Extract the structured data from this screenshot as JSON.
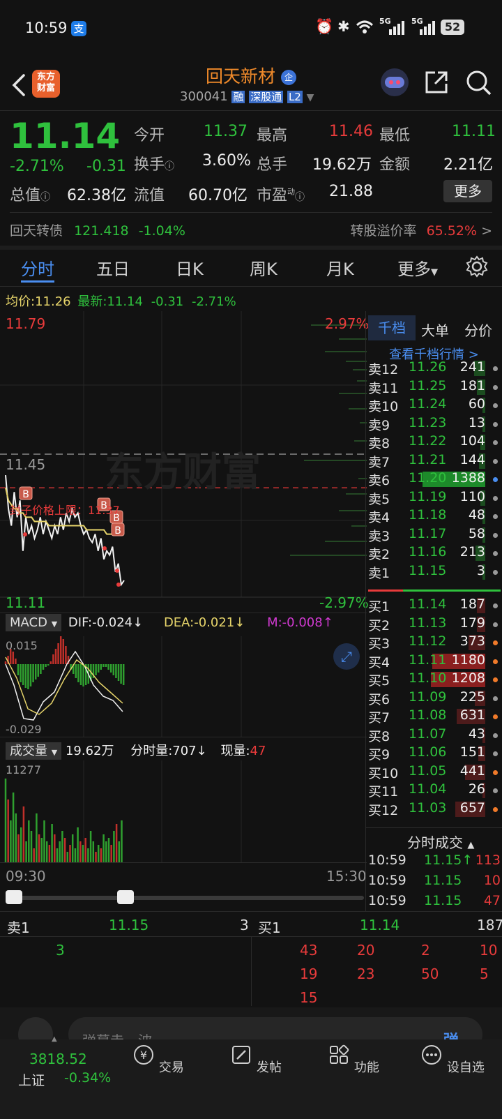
{
  "status": {
    "time": "10:59",
    "pay_badge": "支",
    "battery": "52",
    "net1": "5G",
    "net2": "5G"
  },
  "header": {
    "logo_text": "东方\n财富",
    "stock_name": "回天新材",
    "badge_qi": "企",
    "code": "300041",
    "tag_rong": "融",
    "tag_sgt": "深股通",
    "tag_l2": "L2"
  },
  "quote": {
    "price": "11.14",
    "change_pct": "-2.71%",
    "change": "-0.31",
    "open_label": "今开",
    "open": "11.37",
    "high_label": "最高",
    "high": "11.46",
    "low_label": "最低",
    "low": "11.11",
    "turnover_label": "换手",
    "turnover": "3.60%",
    "volume_label": "总手",
    "volume": "19.62万",
    "amount_label": "金额",
    "amount": "2.21亿",
    "mktcap_label": "总值",
    "mktcap": "62.38亿",
    "float_label": "流值",
    "float": "60.70亿",
    "pe_label": "市盈",
    "pe_sup": "动",
    "pe": "21.88",
    "more_button": "更多"
  },
  "bond": {
    "name": "回天转债",
    "price": "121.418",
    "pct": "-1.04%",
    "premium_label": "转股溢价率",
    "premium": "65.52%",
    "arrow": ">"
  },
  "tabs": [
    "分时",
    "五日",
    "日K",
    "周K",
    "月K",
    "更多"
  ],
  "chart_header": {
    "avg_label": "均价:",
    "avg": "11.26",
    "latest_label": "最新:",
    "latest": "11.14",
    "chg": "-0.31",
    "chg_pct": "-2.71%"
  },
  "chart": {
    "y_top": "11.79",
    "y_top_pct": "2.97%",
    "y_bottom": "11.11",
    "y_bottom_pct": "-2.97%",
    "ref_price": "11.45",
    "watermark": "东方财富",
    "limit_label": "封子价格上限：11.37",
    "b_marker": "B",
    "time_start": "09:30",
    "time_end": "15:30"
  },
  "chart_data": {
    "type": "line",
    "title": "",
    "xlabel": "",
    "ylabel": "",
    "ylim": [
      11.11,
      11.79
    ],
    "series": [
      {
        "name": "",
        "values": [
          11.4,
          11.32,
          11.28,
          11.36,
          11.3,
          11.34,
          11.22,
          11.3,
          11.26,
          11.28,
          11.25,
          11.27,
          11.3,
          11.26,
          11.29,
          11.27,
          11.25,
          11.28,
          11.26,
          11.3,
          11.27,
          11.31,
          11.29,
          11.32,
          11.3,
          11.31,
          11.28,
          11.26,
          11.27,
          11.25,
          11.24,
          11.26,
          11.22,
          11.25,
          11.2,
          11.22,
          11.21,
          11.23,
          11.17,
          11.19,
          11.14,
          11.15
        ]
      },
      {
        "name": "",
        "values": [
          11.37,
          11.34,
          11.33,
          11.32,
          11.32,
          11.31,
          11.31,
          11.3,
          11.3,
          11.3,
          11.29,
          11.29,
          11.29,
          11.29,
          11.29,
          11.28,
          11.28,
          11.28,
          11.28,
          11.28,
          11.28,
          11.28,
          11.28,
          11.28,
          11.28,
          11.28,
          11.28,
          11.28,
          11.27,
          11.27,
          11.27,
          11.27,
          11.27,
          11.27,
          11.27,
          11.26,
          11.26,
          11.26,
          11.26,
          11.26,
          11.26,
          11.26
        ]
      }
    ]
  },
  "macd": {
    "label": "MACD",
    "dif": "DIF:-0.024↓",
    "dea": "DEA:-0.021↓",
    "m": "M:-0.008↑",
    "top": "0.015",
    "bottom": "-0.029"
  },
  "vol": {
    "label": "成交量",
    "total": "19.62万",
    "fs_label": "分时量:707↓",
    "now_label": "现量:",
    "now": "47",
    "max": "11277"
  },
  "orderbook": {
    "tabs": [
      "千档",
      "大单",
      "分价"
    ],
    "view_link": "查看千档行情 >",
    "asks": [
      {
        "n": "卖12",
        "p": "11.26",
        "q": "241"
      },
      {
        "n": "卖11",
        "p": "11.25",
        "q": "181"
      },
      {
        "n": "卖10",
        "p": "11.24",
        "q": "60"
      },
      {
        "n": "卖9",
        "p": "11.23",
        "q": "13"
      },
      {
        "n": "卖8",
        "p": "11.22",
        "q": "104"
      },
      {
        "n": "卖7",
        "p": "11.21",
        "q": "144"
      },
      {
        "n": "卖6",
        "p": "11.20",
        "q": "1388"
      },
      {
        "n": "卖5",
        "p": "11.19",
        "q": "110"
      },
      {
        "n": "卖4",
        "p": "11.18",
        "q": "48"
      },
      {
        "n": "卖3",
        "p": "11.17",
        "q": "58"
      },
      {
        "n": "卖2",
        "p": "11.16",
        "q": "213"
      },
      {
        "n": "卖1",
        "p": "11.15",
        "q": "3"
      }
    ],
    "bids": [
      {
        "n": "买1",
        "p": "11.14",
        "q": "187"
      },
      {
        "n": "买2",
        "p": "11.13",
        "q": "179"
      },
      {
        "n": "买3",
        "p": "11.12",
        "q": "373"
      },
      {
        "n": "买4",
        "p": "11.11",
        "q": "1180"
      },
      {
        "n": "买5",
        "p": "11.10",
        "q": "1208"
      },
      {
        "n": "买6",
        "p": "11.09",
        "q": "225"
      },
      {
        "n": "买7",
        "p": "11.08",
        "q": "631"
      },
      {
        "n": "买8",
        "p": "11.07",
        "q": "43"
      },
      {
        "n": "买9",
        "p": "11.06",
        "q": "151"
      },
      {
        "n": "买10",
        "p": "11.05",
        "q": "441"
      },
      {
        "n": "买11",
        "p": "11.04",
        "q": "26"
      },
      {
        "n": "买12",
        "p": "11.03",
        "q": "657"
      }
    ],
    "ticks_header": "分时成交",
    "ticks": [
      {
        "t": "10:59",
        "p": "11.15↑",
        "v": "113"
      },
      {
        "t": "10:59",
        "p": "11.15",
        "v": "10"
      },
      {
        "t": "10:59",
        "p": "11.15",
        "v": "47"
      }
    ]
  },
  "queue": {
    "sell_label": "卖1",
    "sell_price": "11.15",
    "sell_qty": "3",
    "buy_label": "买1",
    "buy_price": "11.14",
    "buy_qty": "187",
    "sell_orders": [
      "3"
    ],
    "buy_orders": [
      "43",
      "20",
      "2",
      "10",
      "19",
      "23",
      "50",
      "5",
      "15"
    ]
  },
  "comment": {
    "placeholder": "弹幕走一波",
    "danmu": "弹"
  },
  "bottom_nav": {
    "index_value": "3818.52",
    "index_name": "上证",
    "index_pct": "-0.34%",
    "items": [
      "交易",
      "发帖",
      "功能",
      "设自选"
    ]
  }
}
